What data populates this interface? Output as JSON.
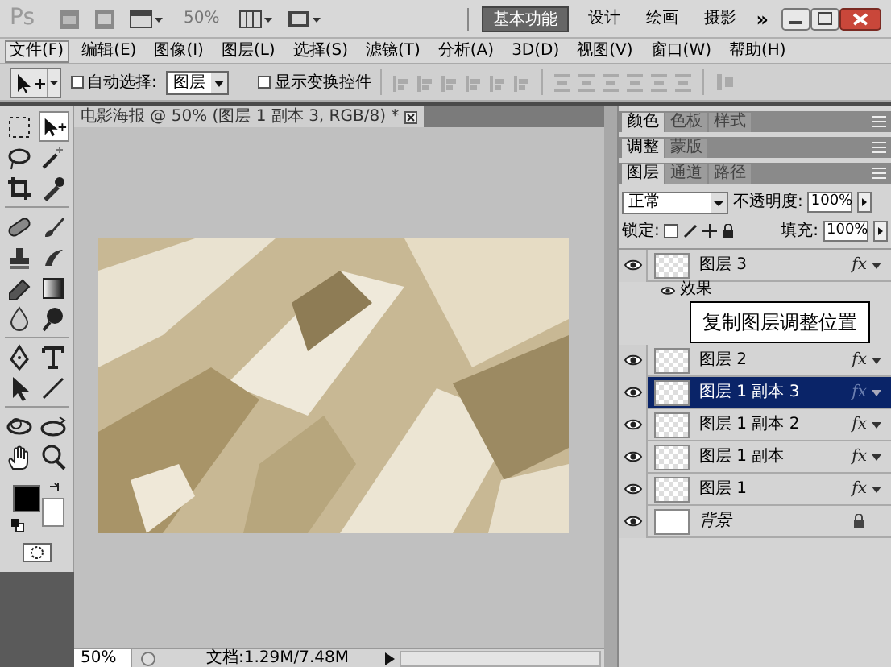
{
  "app_bar": {
    "logo": "Ps",
    "zoom": "50%",
    "more": "»",
    "workspaces": [
      {
        "label": "基本功能",
        "selected": true
      },
      {
        "label": "设计",
        "selected": false
      },
      {
        "label": "绘画",
        "selected": false
      },
      {
        "label": "摄影",
        "selected": false
      }
    ]
  },
  "menu": [
    {
      "label": "文件(F)",
      "selected": true
    },
    {
      "label": "编辑(E)",
      "selected": false
    },
    {
      "label": "图像(I)",
      "selected": false
    },
    {
      "label": "图层(L)",
      "selected": false
    },
    {
      "label": "选择(S)",
      "selected": false
    },
    {
      "label": "滤镜(T)",
      "selected": false
    },
    {
      "label": "分析(A)",
      "selected": false
    },
    {
      "label": "3D(D)",
      "selected": false
    },
    {
      "label": "视图(V)",
      "selected": false
    },
    {
      "label": "窗口(W)",
      "selected": false
    },
    {
      "label": "帮助(H)",
      "selected": false
    }
  ],
  "options_bar": {
    "auto_select": {
      "label": "自动选择:",
      "checked": false
    },
    "auto_select_target": "图层",
    "show_transform": {
      "label": "显示变换控件",
      "checked": false
    }
  },
  "tools": [
    {
      "kind": "marquee",
      "selected": false
    },
    {
      "kind": "move",
      "selected": true
    },
    {
      "kind": "lasso",
      "selected": false
    },
    {
      "kind": "wand",
      "selected": false
    },
    {
      "kind": "crop",
      "selected": false
    },
    {
      "kind": "eyedropper",
      "selected": false
    },
    {
      "kind": "healing",
      "selected": false
    },
    {
      "kind": "brush",
      "selected": false
    },
    {
      "kind": "stamp",
      "selected": false
    },
    {
      "kind": "history",
      "selected": false
    },
    {
      "kind": "eraser",
      "selected": false
    },
    {
      "kind": "gradient",
      "selected": false
    },
    {
      "kind": "blur",
      "selected": false
    },
    {
      "kind": "dodge",
      "selected": false
    },
    {
      "kind": "pen",
      "selected": false
    },
    {
      "kind": "type",
      "selected": false
    },
    {
      "kind": "select",
      "selected": false
    },
    {
      "kind": "line",
      "selected": false
    },
    {
      "kind": "rotate3d",
      "selected": false
    },
    {
      "kind": "orbit3d",
      "selected": false
    },
    {
      "kind": "hand",
      "selected": false
    },
    {
      "kind": "zoom",
      "selected": false
    }
  ],
  "document": {
    "tab": "电影海报 @ 50% (图层 1 副本 3, RGB/8) *"
  },
  "status_bar": {
    "zoom": "50%",
    "doc_info": "文档:1.29M/7.48M"
  },
  "panels": [
    {
      "tabs": [
        {
          "label": "颜色",
          "selected": true
        },
        {
          "label": "色板",
          "selected": false
        },
        {
          "label": "样式",
          "selected": false
        }
      ]
    },
    {
      "tabs": [
        {
          "label": "调整",
          "selected": true
        },
        {
          "label": "蒙版",
          "selected": false
        }
      ]
    },
    {
      "tabs": [
        {
          "label": "图层",
          "selected": true
        },
        {
          "label": "通道",
          "selected": false
        },
        {
          "label": "路径",
          "selected": false
        }
      ]
    }
  ],
  "layers_panel": {
    "blend_mode": "正常",
    "opacity_label": "不透明度:",
    "opacity": "100%",
    "lock_label": "锁定:",
    "fill_label": "填充:",
    "fill": "100%"
  },
  "layers": [
    {
      "kind": "layer",
      "name": "图层 3",
      "selected": false,
      "fx": "fx",
      "effects": "效果"
    },
    {
      "kind": "layer",
      "name": "图层 2",
      "selected": false,
      "fx": "fx"
    },
    {
      "kind": "layer",
      "name": "图层 1 副本 3",
      "selected": true,
      "fx": "fx"
    },
    {
      "kind": "layer",
      "name": "图层 1 副本 2",
      "selected": false,
      "fx": "fx"
    },
    {
      "kind": "layer",
      "name": "图层 1 副本",
      "selected": false,
      "fx": "fx"
    },
    {
      "kind": "layer",
      "name": "图层 1",
      "selected": false,
      "fx": "fx"
    },
    {
      "kind": "background",
      "name": "背景",
      "selected": false
    }
  ],
  "annotation": "复制图层调整位置"
}
